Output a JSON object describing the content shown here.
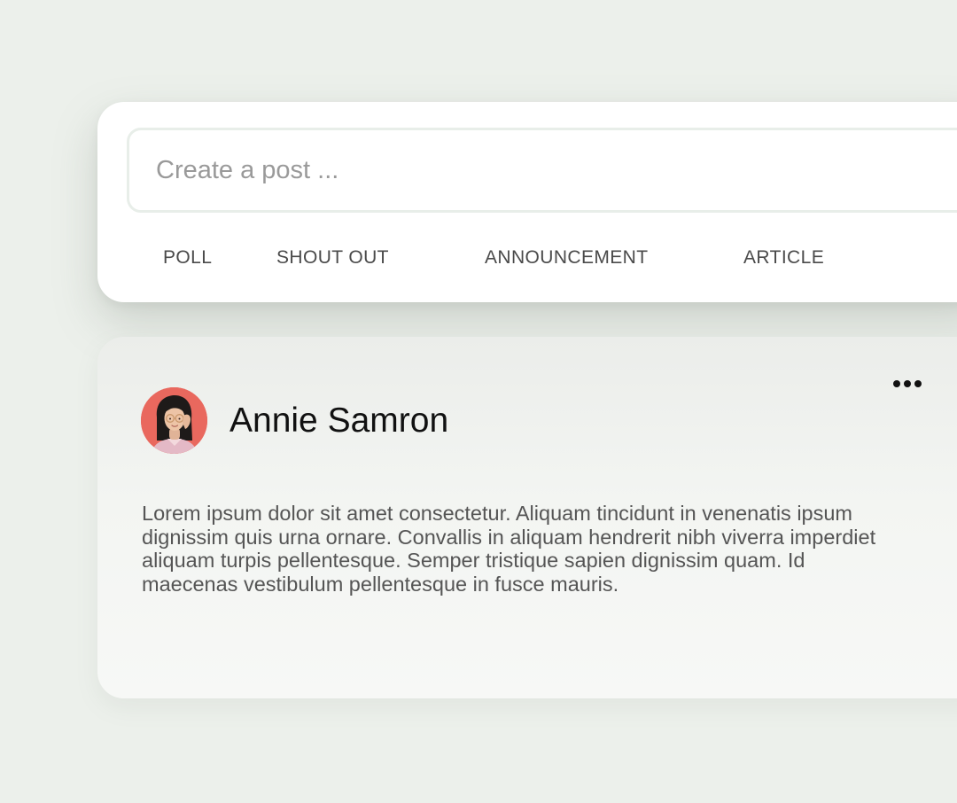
{
  "composer": {
    "placeholder": "Create a post ...",
    "post_types": [
      "POLL",
      "SHOUT OUT",
      "ANNOUNCEMENT",
      "ARTICLE"
    ]
  },
  "post": {
    "author": {
      "name": "Annie Samron"
    },
    "body": "Lorem ipsum dolor sit amet consectetur. Aliquam tincidunt in venenatis ipsum dignissim quis urna ornare. Convallis in aliquam hendrerit nibh viverra imperdiet aliquam turpis pellentesque. Semper tristique sapien dignissim quam. Id maecenas vestibulum pellentesque in fusce mauris.",
    "more_icon": "more-horizontal-icon"
  },
  "colors": {
    "background": "#ecf0eb",
    "avatar_bg": "#e9685e",
    "card": "#ffffff"
  }
}
